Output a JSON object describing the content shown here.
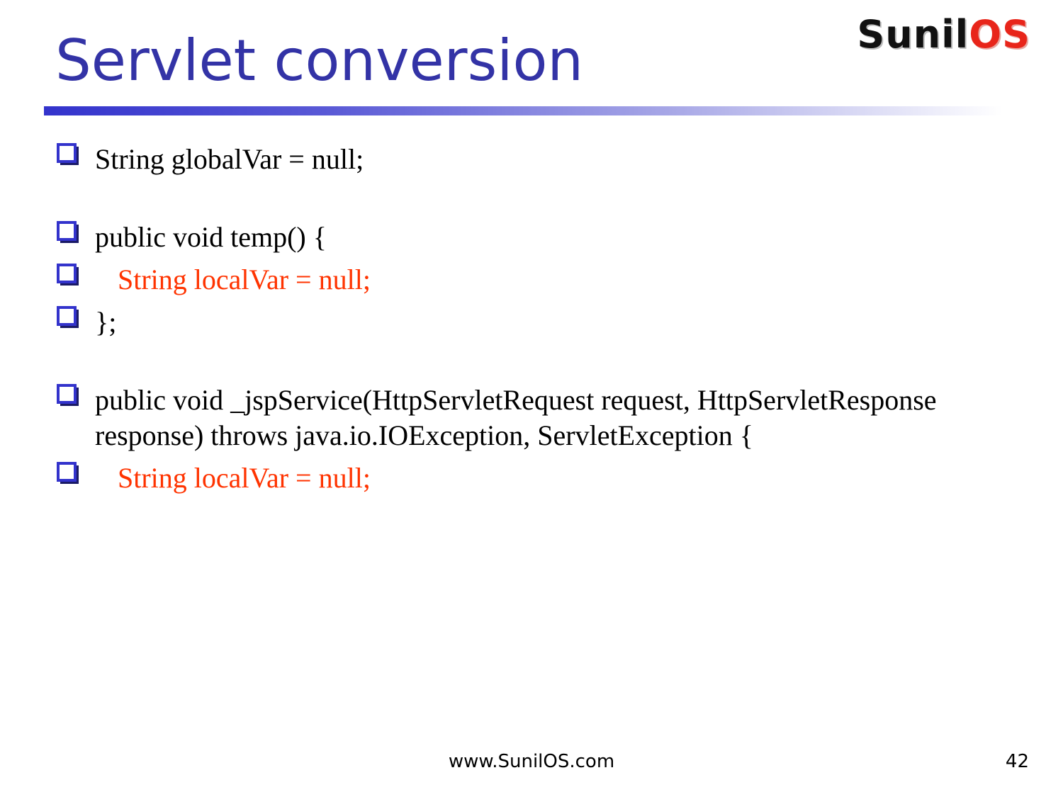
{
  "slide": {
    "title": "Servlet conversion",
    "logo": {
      "part1": "Sunil",
      "part2": "OS"
    },
    "bullet_icon": "checkbox-square-icon",
    "bullets": [
      {
        "text": "String globalVar = null;",
        "color": "#000000"
      },
      {
        "text": "public void temp() {",
        "color": "#000000"
      },
      {
        "text": "String localVar = null;",
        "color": "#ff3300"
      },
      {
        "text": "};",
        "color": "#000000"
      },
      {
        "text": "public void _jspService(HttpServletRequest request, HttpServletResponse response) throws java.io.IOException, ServletException {",
        "color": "#000000"
      },
      {
        "text": "String localVar = null;",
        "color": "#ff3300"
      }
    ],
    "footer": {
      "url": "www.SunilOS.com",
      "page_number": "42"
    }
  },
  "colors": {
    "title": "#3333a6",
    "accent": "#3333cc",
    "highlight": "#ff3300"
  }
}
